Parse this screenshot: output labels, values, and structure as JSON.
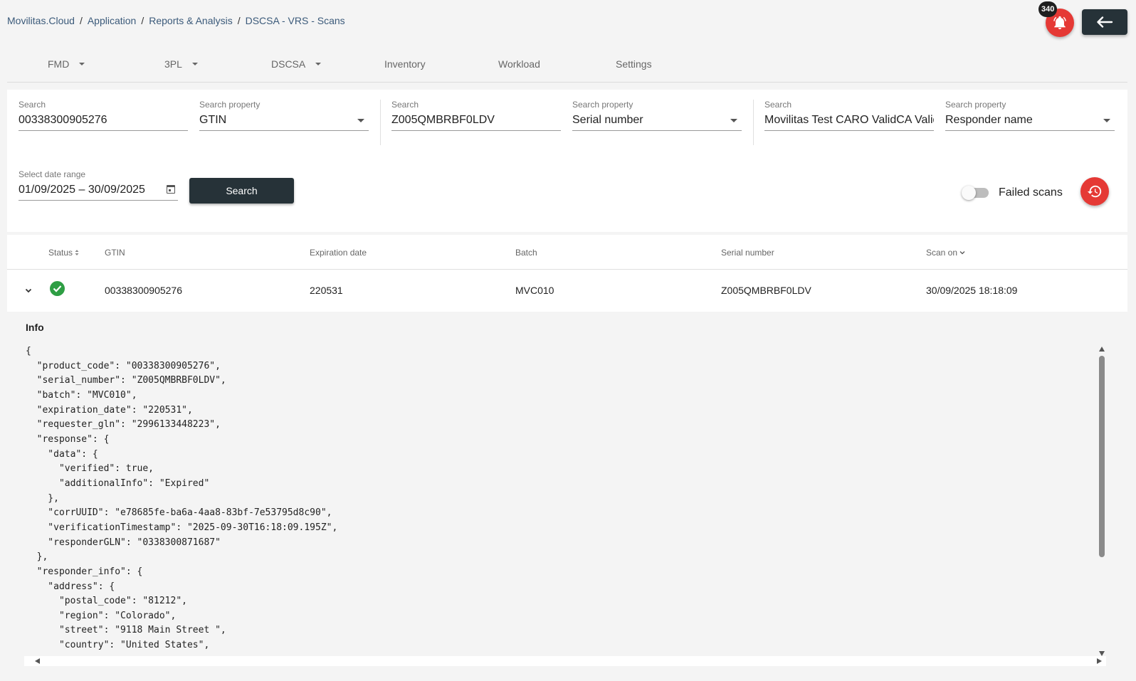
{
  "breadcrumb": [
    {
      "label": "Movilitas.Cloud"
    },
    {
      "label": "Application"
    },
    {
      "label": "Reports & Analysis"
    },
    {
      "label": "DSCSA - VRS - Scans"
    }
  ],
  "header": {
    "notifications_count": "340",
    "icons": {
      "notifications": "bell-icon",
      "back": "arrow-left-icon"
    }
  },
  "nav": {
    "tabs": [
      {
        "label": "FMD",
        "dropdown": true
      },
      {
        "label": "3PL",
        "dropdown": true
      },
      {
        "label": "DSCSA",
        "dropdown": true
      },
      {
        "label": "Inventory",
        "dropdown": false
      },
      {
        "label": "Workload",
        "dropdown": false
      },
      {
        "label": "Settings",
        "dropdown": false
      }
    ]
  },
  "filters": {
    "search1": {
      "label": "Search",
      "value": "00338300905276"
    },
    "property1": {
      "label": "Search property",
      "value": "GTIN"
    },
    "search2": {
      "label": "Search",
      "value": "Z005QMBRBF0LDV"
    },
    "property2": {
      "label": "Search property",
      "value": "Serial number"
    },
    "search3": {
      "label": "Search",
      "value": "Movilitas Test CARO ValidCA Validation"
    },
    "property3": {
      "label": "Search property",
      "value": "Responder name"
    },
    "date_range": {
      "label": "Select date range",
      "value": "01/09/2025 – 30/09/2025"
    },
    "search_button": "Search",
    "failed_scans": {
      "label": "Failed scans",
      "enabled": false
    }
  },
  "table": {
    "columns": [
      "Status",
      "GTIN",
      "Expiration date",
      "Batch",
      "Serial number",
      "Scan on"
    ],
    "rows": [
      {
        "status": "success",
        "gtin": "00338300905276",
        "expiration_date": "220531",
        "batch": "MVC010",
        "serial_number": "Z005QMBRBF0LDV",
        "scan_on": "30/09/2025 18:18:09"
      }
    ]
  },
  "detail": {
    "title": "Info",
    "json_text": "{\n  \"product_code\": \"00338300905276\",\n  \"serial_number\": \"Z005QMBRBF0LDV\",\n  \"batch\": \"MVC010\",\n  \"expiration_date\": \"220531\",\n  \"requester_gln\": \"2996133448223\",\n  \"response\": {\n    \"data\": {\n      \"verified\": true,\n      \"additionalInfo\": \"Expired\"\n    },\n    \"corrUUID\": \"e78685fe-ba6a-4aa8-83bf-7e53795d8c90\",\n    \"verificationTimestamp\": \"2025-09-30T16:18:09.195Z\",\n    \"responderGLN\": \"0338300871687\"\n  },\n  \"responder_info\": {\n    \"address\": {\n      \"postal_code\": \"81212\",\n      \"region\": \"Colorado\",\n      \"street\": \"9118 Main Street \",\n      \"country\": \"United States\","
  },
  "colors": {
    "accent_red": "#e53935",
    "dark": "#263238",
    "success_green": "#2e9e44",
    "link": "#3b5a7a"
  }
}
